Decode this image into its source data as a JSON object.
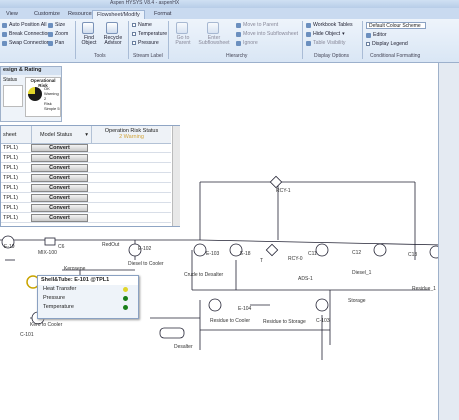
{
  "window": {
    "title": "Aspen HYSYS V8.4 - aspenHX"
  },
  "tabs": [
    {
      "label": "View"
    },
    {
      "label": "Customize"
    },
    {
      "label": "Resources"
    },
    {
      "label": "Flowsheet/Modify"
    },
    {
      "label": "Format"
    }
  ],
  "ribbon": {
    "size": "Size",
    "auto_position_all": "Auto Position All",
    "zoom": "Zoom",
    "break_connection": "Break Connection",
    "swap_connection": "Swap Connection",
    "pan": "Pan",
    "find_object": "Find Object",
    "recycle_advisor": "Recycle Advisor",
    "tools_group": "Tools",
    "name": "Name",
    "temperature": "Temperature",
    "pressure": "Pressure",
    "stream_label_group": "Stream Label",
    "go_to_parent": "Go to Parent",
    "enter_subflowsheet": "Enter Subflowsheet",
    "move_to_parent": "Move to Parent",
    "move_into_subflowsheet": "Move into Subflowsheet",
    "ignore": "Ignore",
    "hierarchy_group": "Hierarchy",
    "workbook_tables": "Workbook Tables",
    "hide_object": "Hide Object",
    "table_visibility": "Table Visibility",
    "display_options_group": "Display Options",
    "colour_scheme": "Default Colour Scheme",
    "editor": "Editor",
    "display_legend": "Display Legend",
    "conditional_formatting_group": "Conditional Formatting"
  },
  "design_panel": {
    "title": "esign & Rating",
    "status_col": "Status",
    "op_risk_title": "Operational Risk",
    "legend": [
      "OK",
      "Warning 2",
      "Risk",
      "Simple 5"
    ]
  },
  "grid": {
    "col_sheet": "sheet",
    "col_model_status": "Model Status",
    "col_operation_risk": "Operation Risk Status",
    "warning_summary": "2 Warning",
    "rows": [
      {
        "name": "TPL1)",
        "button": "Convert"
      },
      {
        "name": "TPL1)",
        "button": "Convert"
      },
      {
        "name": "TPL1)",
        "button": "Convert"
      },
      {
        "name": "TPL1)",
        "button": "Convert"
      },
      {
        "name": "TPL1)",
        "button": "Convert"
      },
      {
        "name": "TPL1)",
        "button": "Convert"
      },
      {
        "name": "TPL1)",
        "button": "Convert"
      },
      {
        "name": "TPL1)",
        "button": "Convert"
      }
    ]
  },
  "popup": {
    "title": "Shell&Tube: E-101 @TPL1",
    "rows": [
      {
        "label": "Heat Transfer",
        "status": "warning"
      },
      {
        "label": "Pressure",
        "status": "ok"
      },
      {
        "label": "Temperature",
        "status": "ok"
      }
    ]
  },
  "colors": {
    "ok": "#1a7f1a",
    "warning": "#e0d52a",
    "accent": "#2c5aa0"
  },
  "flowsheet_labels": {
    "e19": "E-19",
    "c6": "C6",
    "mix100": "MIX-100",
    "kerosene": "Kerosene",
    "redout": "RedOut",
    "e102": "E-102",
    "diesel_to_cooler": "Diesel to Cooler",
    "crude_to_desalter": "Crude to Desalter",
    "residue_to_cooler": "Residue to Cooler",
    "residue_to_storage": "Residue to Storage",
    "e103": "E-103",
    "e104": "E-104",
    "e18": "E-18",
    "rcy0": "RCY-0",
    "rcy1": "RCY-1",
    "c11": "C11",
    "c12": "C12",
    "c13": "C13",
    "diesel1": "Diesel_1",
    "residue1": "Residue_1",
    "desalter": "Desalter",
    "ads1": "ADS-1",
    "c101": "C-101",
    "c103": "C-103",
    "kero_to_cooler": "Kero to Cooler",
    "t": "T",
    "storage": "Storage"
  }
}
